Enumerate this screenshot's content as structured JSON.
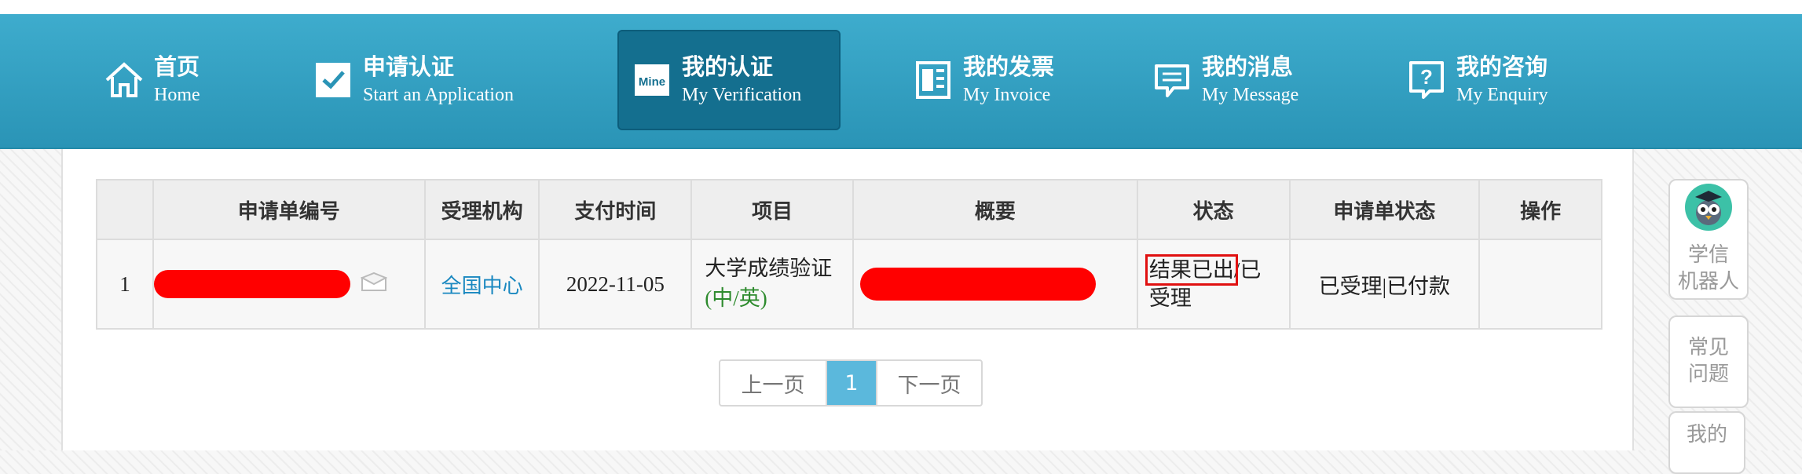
{
  "nav": {
    "items": [
      {
        "cn": "首页",
        "en": "Home",
        "icon": "home-icon"
      },
      {
        "cn": "申请认证",
        "en": "Start an Application",
        "icon": "checkbox-icon"
      },
      {
        "cn": "我的认证",
        "en": "My Verification",
        "icon": "mine-icon",
        "active": true
      },
      {
        "cn": "我的发票",
        "en": "My Invoice",
        "icon": "invoice-icon"
      },
      {
        "cn": "我的消息",
        "en": "My Message",
        "icon": "message-icon"
      },
      {
        "cn": "我的咨询",
        "en": "My Enquiry",
        "icon": "question-icon"
      }
    ]
  },
  "table": {
    "headers": [
      "",
      "申请单编号",
      "受理机构",
      "支付时间",
      "项目",
      "概要",
      "状态",
      "申请单状态",
      "操作"
    ],
    "rows": [
      {
        "index": "1",
        "agency": "全国中心",
        "pay_time": "2022-11-05",
        "project": "大学成绩验证",
        "project_lang": "(中/英)",
        "status_highlight": "结果已出",
        "status_rest_1": "/已",
        "status_rest_2": "受理",
        "app_status": "已受理|已付款",
        "action": ""
      }
    ]
  },
  "pager": {
    "prev": "上一页",
    "current": "1",
    "next": "下一页"
  },
  "float": {
    "robot": "学信\n机器人",
    "faq_1": "常见",
    "faq_2": "问题",
    "mine": "我的"
  },
  "colors": {
    "nav": "#2a94b6",
    "nav_active": "#146f8f",
    "link": "#1a88c0",
    "redaction": "#ff0000",
    "pager_active": "#5bb8dc"
  }
}
